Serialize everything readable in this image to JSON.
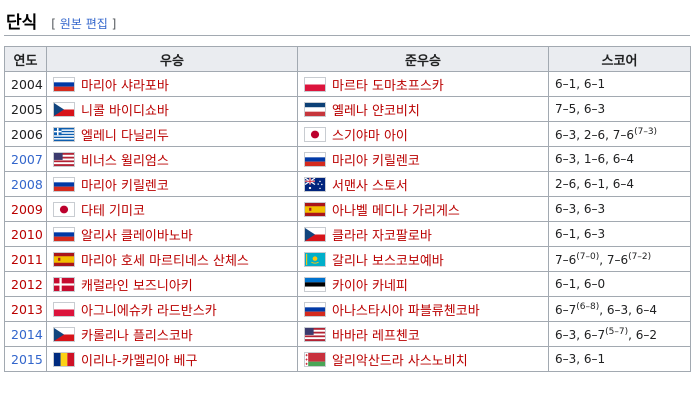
{
  "section": {
    "title": "단식",
    "edit_open": "[",
    "edit_link": "원본 편집",
    "edit_close": "]"
  },
  "table": {
    "headers": [
      "연도",
      "우승",
      "준우승",
      "스코어"
    ],
    "rows": [
      {
        "year": "2004",
        "year_color": "black",
        "winner": "마리아 샤라포바",
        "winner_flag": "russia-flag-icon",
        "runner": "마르타 도마초프스카",
        "runner_flag": "poland-flag-icon",
        "score": [
          {
            "t": "6–1, 6–1"
          }
        ]
      },
      {
        "year": "2005",
        "year_color": "black",
        "winner": "니콜 바이디쇼바",
        "winner_flag": "czech-flag-icon",
        "runner": "옐레나 얀코비치",
        "runner_flag": "serbia-montenegro-flag-icon",
        "score": [
          {
            "t": "7–5, 6–3"
          }
        ]
      },
      {
        "year": "2006",
        "year_color": "black",
        "winner": "엘레니 다닐리두",
        "winner_flag": "greece-flag-icon",
        "runner": "스기야마 아이",
        "runner_flag": "japan-flag-icon",
        "score": [
          {
            "t": "6–3, 2–6, 7–6"
          },
          {
            "s": "(7–3)"
          }
        ]
      },
      {
        "year": "2007",
        "year_color": "blue",
        "winner": "비너스 윌리엄스",
        "winner_flag": "usa-flag-icon",
        "runner": "마리아 키릴렌코",
        "runner_flag": "russia-flag-icon",
        "score": [
          {
            "t": "6–3, 1–6, 6–4"
          }
        ]
      },
      {
        "year": "2008",
        "year_color": "blue",
        "winner": "마리아 키릴렌코",
        "winner_flag": "russia-flag-icon",
        "runner": "서맨사 스토서",
        "runner_flag": "australia-flag-icon",
        "score": [
          {
            "t": "2–6, 6–1, 6–4"
          }
        ]
      },
      {
        "year": "2009",
        "year_color": "red",
        "winner": "다테 기미코",
        "winner_flag": "japan-flag-icon",
        "runner": "아나벨 메디나 가리게스",
        "runner_flag": "spain-flag-icon",
        "score": [
          {
            "t": "6–3, 6–3"
          }
        ]
      },
      {
        "year": "2010",
        "year_color": "red",
        "winner": "알리사 클레이바노바",
        "winner_flag": "russia-flag-icon",
        "runner": "클라라 자코팔로바",
        "runner_flag": "czech-flag-icon",
        "score": [
          {
            "t": "6–1, 6–3"
          }
        ]
      },
      {
        "year": "2011",
        "year_color": "red",
        "winner": "마리아 호세 마르티네스 산체스",
        "winner_flag": "spain-flag-icon",
        "runner": "갈리나 보스코보예바",
        "runner_flag": "kazakhstan-flag-icon",
        "score": [
          {
            "t": "7–6"
          },
          {
            "s": "(7–0)"
          },
          {
            "t": ", 7–6"
          },
          {
            "s": "(7–2)"
          }
        ]
      },
      {
        "year": "2012",
        "year_color": "red",
        "winner": "캐럴라인 보즈니아키",
        "winner_flag": "denmark-flag-icon",
        "runner": "카이아 카네피",
        "runner_flag": "estonia-flag-icon",
        "score": [
          {
            "t": "6–1, 6–0"
          }
        ]
      },
      {
        "year": "2013",
        "year_color": "red",
        "winner": "아그니에슈카 라드반스카",
        "winner_flag": "poland-flag-icon",
        "runner": "아나스타시아 파블류첸코바",
        "runner_flag": "russia-flag-icon",
        "score": [
          {
            "t": "6–7"
          },
          {
            "s": "(6–8)"
          },
          {
            "t": ", 6–3, 6–4"
          }
        ]
      },
      {
        "year": "2014",
        "year_color": "blue",
        "winner": "카롤리나 플리스코바",
        "winner_flag": "czech-flag-icon",
        "runner": "바바라 레프첸코",
        "runner_flag": "usa-flag-icon",
        "score": [
          {
            "t": "6–3, 6–7"
          },
          {
            "s": "(5–7)"
          },
          {
            "t": ", 6–2"
          }
        ]
      },
      {
        "year": "2015",
        "year_color": "blue",
        "winner": "이리나-카멜리아 베구",
        "winner_flag": "romania-flag-icon",
        "runner": "알리악산드라 사스노비치",
        "runner_flag": "belarus-flag-icon",
        "score": [
          {
            "t": "6–3, 6–1"
          }
        ]
      }
    ]
  },
  "colors": {
    "link_blue": "#3366cc",
    "link_red": "#ba0000",
    "header_bg": "#eaecf0",
    "border": "#a2a9b1"
  }
}
